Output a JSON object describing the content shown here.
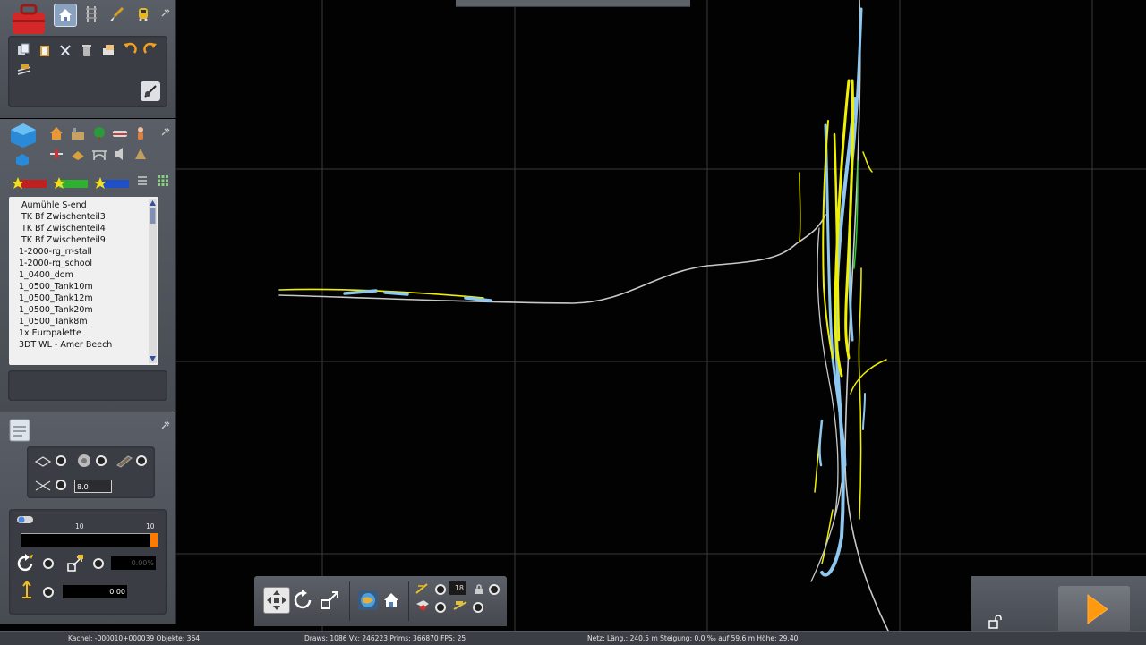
{
  "sidebar": {
    "objects_list": [
      "Aumühle S-end",
      "TK Bf Zwischenteil3",
      "TK Bf Zwischenteil4",
      "TK Bf Zwischenteil9",
      "1-2000-rg_rr-stall",
      "1-2000-rg_school",
      "1_0400_dom",
      "1_0500_Tank10m",
      "1_0500_Tank12m",
      "1_0500_Tank20m",
      "1_0500_Tank8m",
      "1x Europalette",
      "3DT WL - Amer Beech"
    ],
    "spacing_value": "8.0",
    "slider_min_label": "10",
    "slider_max_label": "10",
    "slider_level_fraction": 1.0,
    "rotation_value": "0.00%",
    "height_value": "0.00"
  },
  "nav_toolbar": {
    "layer_value": "18"
  },
  "status_bar": {
    "tile": "Kachel: -000010+000039  Objekte: 364",
    "render": "Draws: 1086 Vx: 246223 Prims: 366870 FPS: 25",
    "net": "Netz:  Läng.:  240.5 m  Steigung:  0.0 ‰ auf 59.6 m  Höhe:  29.40"
  },
  "colors": {
    "panel": "#4f535a",
    "grid": "#3a3a3a",
    "track_gray": "#c8c8c8",
    "track_yellow": "#f0f000",
    "track_blue": "#8ec8f0",
    "track_green": "#28d028",
    "accent_orange": "#ff7a00"
  }
}
